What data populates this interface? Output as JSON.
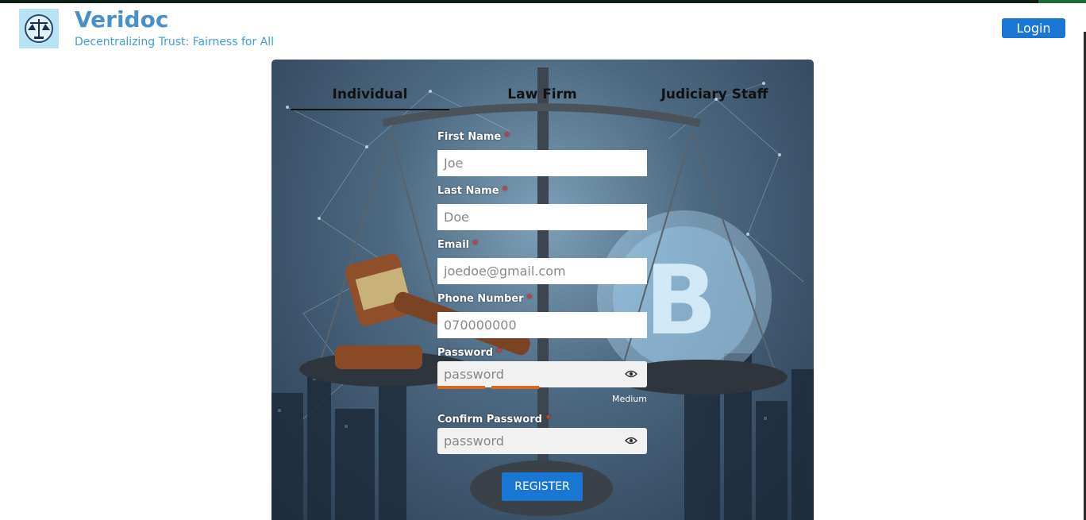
{
  "header": {
    "brand": "Veridoc",
    "tagline": "Decentralizing Trust: Fairness for All",
    "login_label": "Login",
    "logo_icon": "justice-logo-icon"
  },
  "tabs": [
    {
      "label": "Individual",
      "active": true
    },
    {
      "label": "Law Firm",
      "active": false
    },
    {
      "label": "Judiciary Staff",
      "active": false
    }
  ],
  "form": {
    "first_name": {
      "label": "First Name",
      "placeholder": "Joe"
    },
    "last_name": {
      "label": "Last Name",
      "placeholder": "Doe"
    },
    "email": {
      "label": "Email",
      "placeholder": "joedoe@gmail.com"
    },
    "phone": {
      "label": "Phone Number",
      "placeholder": "070000000"
    },
    "password": {
      "label": "Password",
      "placeholder": "password"
    },
    "confirm_password": {
      "label": "Confirm Password",
      "placeholder": "password"
    },
    "required_mark": "*",
    "strength_text": "Medium",
    "strength_level": 0.5,
    "register_label": "REGISTER"
  },
  "colors": {
    "primary": "#1976d2",
    "brand": "#4a90c8",
    "tagline": "#3aa0d8",
    "required": "#e53935",
    "strength": "#d2691e"
  }
}
